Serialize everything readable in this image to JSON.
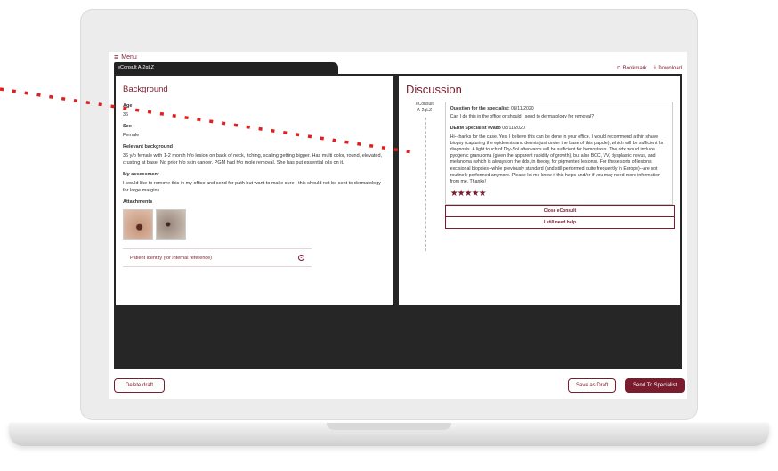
{
  "app": {
    "menu_label": "Menu",
    "consult_tab": "eConsult A-2qLZ",
    "bookmark_label": "Bookmark",
    "download_label": "Download"
  },
  "background": {
    "title": "Background",
    "age_label": "Age",
    "age_value": "36",
    "sex_label": "Sex",
    "sex_value": "Female",
    "relevant_label": "Relevant background",
    "relevant_value": "36 y/o female with 1-2 month h/o lesion on back of neck, itching, scaling getting bigger. Has multi color, round, elevated, crusting at base. No prior h/o skin cancer. PGM had h/o mole removal. She has put essential oils on it.",
    "assessment_label": "My assessment",
    "assessment_value": "I would like to remove this in my office and send for path but want to make sure I this should not be sent to dermatology for large margins",
    "attachments_label": "Attachments",
    "identity_label": "Patient identity (for internal reference)"
  },
  "discussion": {
    "title": "Discussion",
    "consult_id_line1": "eConsult",
    "consult_id_line2": "A-2qLZ",
    "question_head": "Question for the specialist:",
    "question_date": "08/11/2020",
    "question_text": "Can I do this in the office or should I send to dermatology for removal?",
    "answer_head": "DERM Specialist #va8o",
    "answer_date": "08/11/2020",
    "answer_text": "Hi--thanks for the case. Yes, I believe this can be done in your office. I would recommend a thin shave biopsy (capturing the epidermis and dermis just under the base of this papule), which will be sufficient for diagnosis. A light touch of Dry-Sol afterwards will be sufficient for hemostasis. The ddx would include pyogenic granuloma (given the apparent rapidity of growth), but also BCC, VV, dysplastic nevus, and melanoma (which is always on the ddx, in theory, for pigmented lesions). For these sorts of lesions, excisional biopsies--while previously standard (and still performed quite frequently in Europe)--are not routinely performed anymore. Please let me know if this helps and/or if you may need more information from me. Thanks!",
    "rating_stars": 5,
    "close_button": "Close eConsult",
    "help_button": "I still need help"
  },
  "footer": {
    "delete_label": "Delete draft",
    "save_label": "Save as Draft",
    "send_label": "Send To Specialist"
  },
  "colors": {
    "accent": "#7a1c2e",
    "pointer": "#e02020"
  }
}
